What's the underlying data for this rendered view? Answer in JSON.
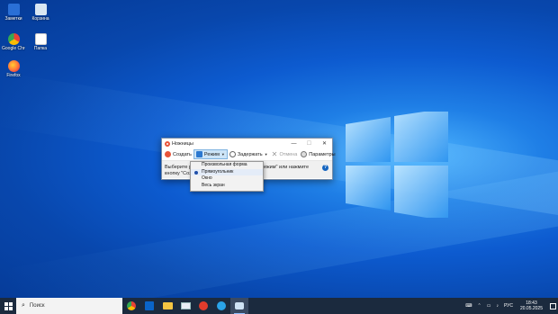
{
  "desktop": {
    "icons": [
      {
        "label": "Заметки",
        "color": "#2a6fd6"
      },
      {
        "label": "Корзина",
        "color": "#d9e6f2"
      },
      {
        "label": "Google Chrome",
        "color": "#e94235"
      },
      {
        "label": "Папка",
        "color": "#ffffff"
      },
      {
        "label": "Firefox",
        "color": "#ff7139"
      }
    ]
  },
  "snipping_tool": {
    "title": "Ножницы",
    "minimize": "—",
    "maximize": "☐",
    "close": "✕",
    "toolbar": {
      "create": "Создать",
      "mode": "Режим",
      "delay": "Задержать",
      "cancel": "Отмена",
      "options": "Параметры"
    },
    "info_line1_left": "Выберите ре",
    "info_line1_right": "ежим\" или нажмите",
    "info_line2": "кнопку \"Созд",
    "help": "?"
  },
  "mode_menu": {
    "items": [
      {
        "label": "Произвольная форма",
        "selected": false
      },
      {
        "label": "Прямоугольник",
        "selected": true
      },
      {
        "label": "Окно",
        "selected": false
      },
      {
        "label": "Весь экран",
        "selected": false
      }
    ]
  },
  "taskbar": {
    "search_placeholder": "Поиск",
    "language": "РУС",
    "time": "18:43",
    "date": "20.05.2025",
    "apps": [
      "chrome",
      "outlook",
      "file-explorer",
      "mail",
      "yandex",
      "messenger",
      "snipping-tool"
    ]
  }
}
